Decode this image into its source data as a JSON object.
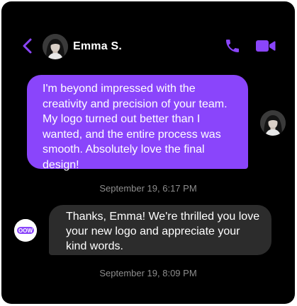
{
  "header": {
    "contact_name": "Emma S.",
    "back_icon": "chevron-left-icon",
    "call_icon": "phone-icon",
    "video_icon": "video-camera-icon"
  },
  "messages": [
    {
      "direction": "outgoing",
      "text": "I'm beyond impressed with the creativity and precision of your team. My logo turned out better than I wanted, and the entire process was smooth. Absolutely love the final design!",
      "timestamp": "September 19, 6:17 PM"
    },
    {
      "direction": "incoming",
      "text": "Thanks, Emma! We're thrilled you love your new logo and appreciate your kind words.",
      "timestamp": "September 19, 8:09 PM"
    }
  ],
  "brand": {
    "avatar_text": "OOW"
  },
  "colors": {
    "accent": "#8a45fb",
    "background": "#000000",
    "incoming_bubble": "#2c2c2c",
    "timestamp": "#8d8d8d"
  }
}
